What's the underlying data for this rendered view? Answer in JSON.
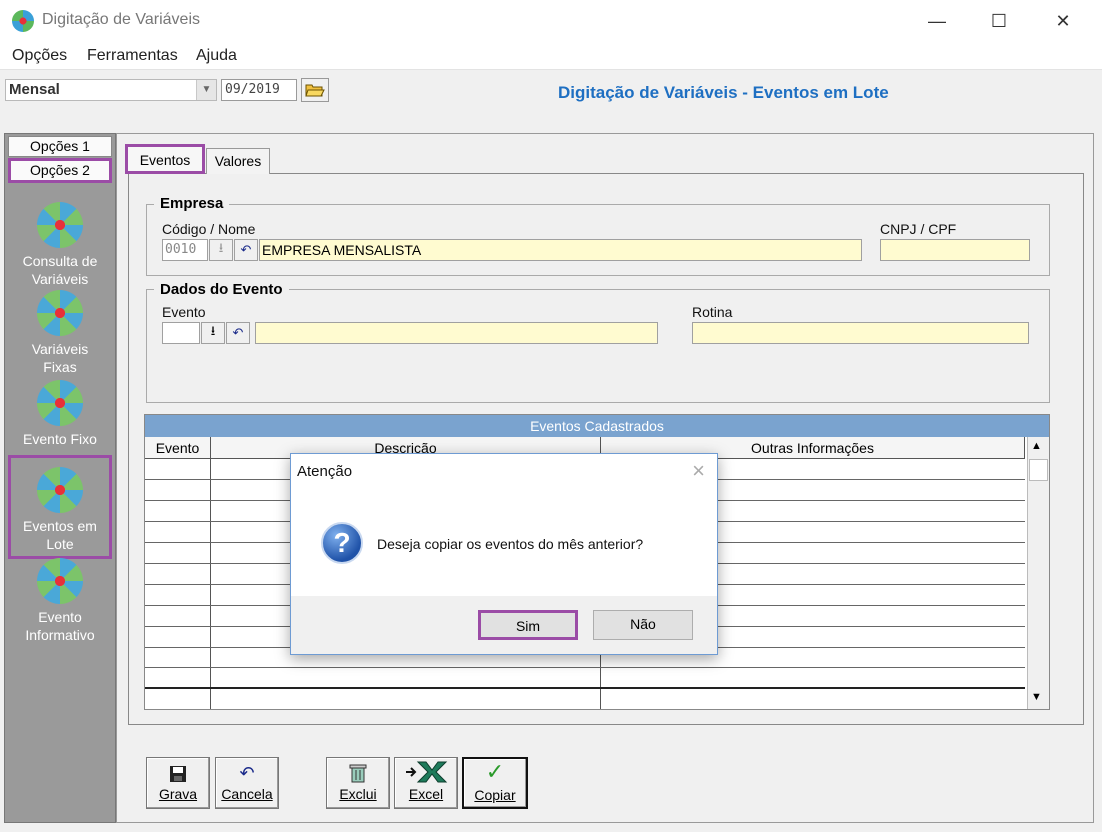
{
  "window": {
    "title": "Digitação de Variáveis",
    "minimize": "—",
    "maximize": "☐",
    "close": "✕"
  },
  "menu": [
    "Opções",
    "Ferramentas",
    "Ajuda"
  ],
  "toolbar": {
    "period_select": "Mensal",
    "month_value": "09/2019",
    "page_title": "Digitação de Variáveis - Eventos em Lote"
  },
  "sidebar": {
    "tabs": [
      "Opções 1",
      "Opções 2"
    ],
    "items": [
      {
        "line1": "Consulta de",
        "line2": "Variáveis"
      },
      {
        "line1": "Variáveis",
        "line2": "Fixas"
      },
      {
        "line1": "Evento Fixo",
        "line2": ""
      },
      {
        "line1": "Eventos em",
        "line2": "Lote"
      },
      {
        "line1": "Evento",
        "line2": "Informativo"
      }
    ]
  },
  "tabs": [
    "Eventos",
    "Valores"
  ],
  "empresa": {
    "group_title": "Empresa",
    "codigo_label": "Código / Nome",
    "codigo_value": "0010",
    "nome_value": "EMPRESA MENSALISTA",
    "cnpj_label": "CNPJ / CPF",
    "cnpj_value": ""
  },
  "evento_group": {
    "group_title": "Dados do Evento",
    "evento_label": "Evento",
    "evento_value": "",
    "rotina_label": "Rotina",
    "rotina_value": ""
  },
  "grid": {
    "caption": "Eventos Cadastrados",
    "columns": [
      "Evento",
      "Descrição",
      "Outras Informações"
    ]
  },
  "dialog": {
    "title": "Atenção",
    "message": "Deseja copiar os eventos do mês anterior?",
    "yes": "Sim",
    "no": "Não"
  },
  "buttons": [
    {
      "label": "Grava",
      "icon": "save-icon"
    },
    {
      "label": "Cancela",
      "icon": "undo-icon"
    },
    {
      "label": "Exclui",
      "icon": "trash-icon"
    },
    {
      "label": "Excel",
      "icon": "excel-icon"
    },
    {
      "label": "Copiar",
      "icon": "check-icon"
    }
  ],
  "colors": {
    "accent": "#1e6fc2",
    "highlight": "#9b4ca6",
    "field_yellow": "#fffbd0",
    "grid_caption": "#7aa3cf"
  }
}
